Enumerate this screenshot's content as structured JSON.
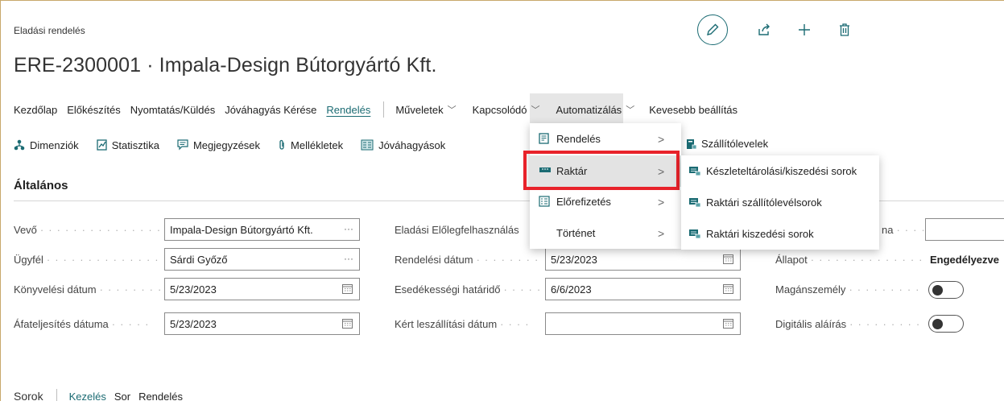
{
  "page": {
    "caption": "Eladási rendelés",
    "title": "ERE-2300001 · Impala-Design Bútorgyártó Kft."
  },
  "top_icons": [
    "edit-icon",
    "share-icon",
    "plus-icon",
    "trash-icon"
  ],
  "action_bar": {
    "items": [
      {
        "label": "Kezdőlap"
      },
      {
        "label": "Előkészítés"
      },
      {
        "label": "Nyomtatás/Küldés"
      },
      {
        "label": "Jóváhagyás Kérése"
      },
      {
        "label": "Rendelés",
        "active": true
      }
    ],
    "menus": [
      {
        "label": "Műveletek"
      },
      {
        "label": "Kapcsolódó",
        "open": true
      },
      {
        "label": "Automatizálás"
      },
      {
        "label": "Kevesebb beállítás"
      }
    ]
  },
  "toolbar": {
    "items": [
      {
        "label": "Dimenziók",
        "icon": "dimensions-icon"
      },
      {
        "label": "Statisztika",
        "icon": "statistics-icon"
      },
      {
        "label": "Megjegyzések",
        "icon": "comments-icon"
      },
      {
        "label": "Mellékletek",
        "icon": "paperclip-icon"
      },
      {
        "label": "Jóváhagyások",
        "icon": "approvals-icon"
      }
    ],
    "after_menu": {
      "label": "Szállítólevelek",
      "icon": "shipment-icon"
    }
  },
  "section": {
    "title": "Általános"
  },
  "fields": {
    "vevo": {
      "label": "Vevő",
      "value": "Impala-Design Bútorgyártó Kft.",
      "suffix": "···"
    },
    "ugyfel": {
      "label": "Ügyfél",
      "value": "Sárdi Győző",
      "suffix": "···"
    },
    "konyvelesi_datum": {
      "label": "Könyvelési dátum",
      "value": "5/23/2023"
    },
    "afateljesites": {
      "label": "Áfateljesítés dátuma",
      "value": "5/23/2023"
    },
    "eloleg": {
      "label": "Eladási Előlegfelhasználás",
      "value": ""
    },
    "rendelesi_datum": {
      "label": "Rendelési dátum",
      "value": "5/23/2023"
    },
    "esedekessegi": {
      "label": "Esedékességi határidő",
      "value": "6/6/2023"
    },
    "kert_szallitasi": {
      "label": "Kért leszállítási dátum",
      "value": ""
    },
    "col3_first": {
      "label": "na",
      "value": ""
    },
    "allapot": {
      "label": "Állapot",
      "value": "Engedélyezve"
    },
    "maganszemely": {
      "label": "Magánszemély",
      "value": false
    },
    "digitalis": {
      "label": "Digitális aláírás",
      "value": false
    }
  },
  "related_menu": {
    "items": [
      {
        "label": "Rendelés",
        "icon": "order-icon"
      },
      {
        "label": "Raktár",
        "icon": "warehouse-icon",
        "highlighted": true
      },
      {
        "label": "Előrefizetés",
        "icon": "prepayment-icon"
      },
      {
        "label": "Történet",
        "icon": ""
      }
    ]
  },
  "warehouse_submenu": {
    "items": [
      {
        "label": "Készleteltárolási/kiszedési sorok"
      },
      {
        "label": "Raktári szállítólevélsorok"
      },
      {
        "label": "Raktári kiszedési sorok"
      }
    ]
  },
  "bottom_tabs": {
    "title": "Sorok",
    "items": [
      {
        "label": "Kezelés",
        "link": true
      },
      {
        "label": "Sor"
      },
      {
        "label": "Rendelés"
      }
    ]
  },
  "colors": {
    "accent": "#1b6b73",
    "highlight_box": "#e8222a",
    "menu_hover": "#e3e3e3"
  }
}
